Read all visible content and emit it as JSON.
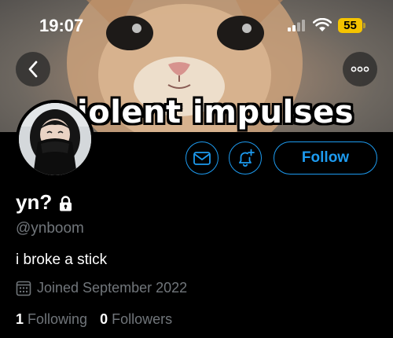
{
  "status_bar": {
    "time": "19:07",
    "battery": "55",
    "icons": [
      "signal-icon",
      "wifi-icon",
      "battery-icon"
    ],
    "battery_color": "#f5c400"
  },
  "banner": {
    "caption": "iolent impulses"
  },
  "nav": {
    "back_icon": "chevron-left-icon",
    "more_icon": "more-horizontal-icon"
  },
  "actions": {
    "message_icon": "envelope-icon",
    "notify_icon": "bell-plus-icon",
    "follow_label": "Follow",
    "accent_color": "#1d9bf0"
  },
  "profile": {
    "display_name": "yn?",
    "handle": "@ynboom",
    "bio": "i broke a stick",
    "joined": "Joined September 2022",
    "following_count": "1",
    "following_label": "Following",
    "followers_count": "0",
    "followers_label": "Followers",
    "protected_icon": "lock-icon"
  }
}
